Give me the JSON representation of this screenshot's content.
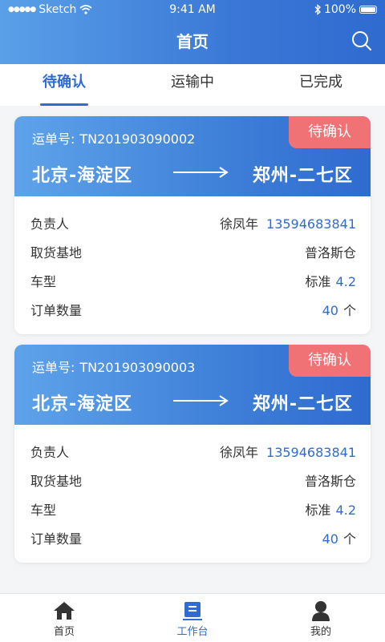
{
  "status_bar": {
    "carrier": "Sketch",
    "time": "9:41 AM",
    "battery": "100%"
  },
  "header": {
    "title": "首页"
  },
  "tabs": [
    {
      "label": "待确认",
      "active": true
    },
    {
      "label": "运输中",
      "active": false
    },
    {
      "label": "已完成",
      "active": false
    }
  ],
  "cards": [
    {
      "waybill_label": "运单号:",
      "waybill_number": "TN201903090002",
      "status": "待确认",
      "from": "北京-海淀区",
      "to": "郑州-二七区",
      "rows": {
        "owner_label": "负责人",
        "owner_name": "徐凤年",
        "owner_phone": "13594683841",
        "pickup_label": "取货基地",
        "pickup_value": "普洛斯仓",
        "vehicle_label": "车型",
        "vehicle_type": "标准",
        "vehicle_size": "4.2",
        "qty_label": "订单数量",
        "qty_value": "40",
        "qty_unit": "个"
      }
    },
    {
      "waybill_label": "运单号:",
      "waybill_number": "TN201903090003",
      "status": "待确认",
      "from": "北京-海淀区",
      "to": "郑州-二七区",
      "rows": {
        "owner_label": "负责人",
        "owner_name": "徐凤年",
        "owner_phone": "13594683841",
        "pickup_label": "取货基地",
        "pickup_value": "普洛斯仓",
        "vehicle_label": "车型",
        "vehicle_type": "标准",
        "vehicle_size": "4.2",
        "qty_label": "订单数量",
        "qty_value": "40",
        "qty_unit": "个"
      }
    }
  ],
  "bottom_nav": [
    {
      "label": "首页",
      "icon": "home-icon",
      "active": false
    },
    {
      "label": "工作台",
      "icon": "workbench-icon",
      "active": true
    },
    {
      "label": "我的",
      "icon": "user-icon",
      "active": false
    }
  ],
  "colors": {
    "primary": "#2f6bd0",
    "badge": "#f07275",
    "background": "#f4f5f7"
  }
}
